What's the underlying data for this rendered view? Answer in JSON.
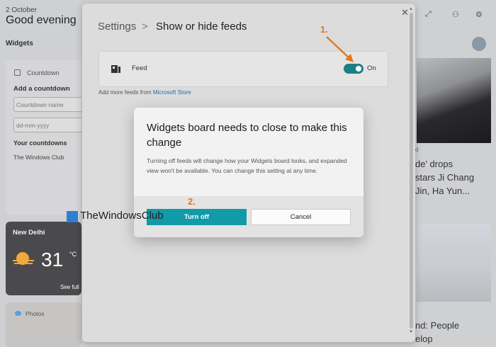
{
  "board": {
    "date": "2 October",
    "greeting": "Good evening",
    "widgets_label": "Widgets",
    "countdown": {
      "title": "Countdown",
      "add_label": "Add a countdown",
      "name_placeholder": "Countdown name",
      "date_placeholder": "dd-mm-yyyy",
      "yours_label": "Your countdowns",
      "item": "The Windows Club"
    },
    "weather": {
      "city": "New Delhi",
      "temp": "31",
      "unit": "°C",
      "see_full": "See full"
    },
    "photos": {
      "title": "Photos"
    },
    "news": {
      "small": "d",
      "headline_lines": [
        "de' drops",
        "stars Ji Chang",
        "Jin, Ha Yun..."
      ],
      "headline2_lines": [
        "nd: People",
        "elop"
      ]
    }
  },
  "settings": {
    "breadcrumb_root": "Settings",
    "breadcrumb_sep": ">",
    "breadcrumb_page": "Show or hide feeds",
    "feed_label": "Feed",
    "toggle_state": "On",
    "more_feeds_prefix": "Add more feeds from ",
    "more_feeds_link": "Microsoft Store"
  },
  "dialog": {
    "title": "Widgets board needs to close to make this change",
    "body": "Turning off feeds will change how your Widgets board looks, and expanded view won't be available. You can change this setting at any time.",
    "primary_label": "Turn off",
    "secondary_label": "Cancel"
  },
  "annotations": {
    "step1": "1.",
    "step2": "2."
  },
  "watermark": {
    "text": "TheWindowsClub"
  },
  "colors": {
    "accent": "#119aa8",
    "toggle_on": "#1b7f87",
    "annotation": "#e07a1f",
    "link": "#1a6fb0"
  },
  "icons": [
    "close-icon",
    "expand-icon",
    "people-icon",
    "gear-icon",
    "feed-icon",
    "sun-icon",
    "photos-icon",
    "countdown-icon"
  ]
}
